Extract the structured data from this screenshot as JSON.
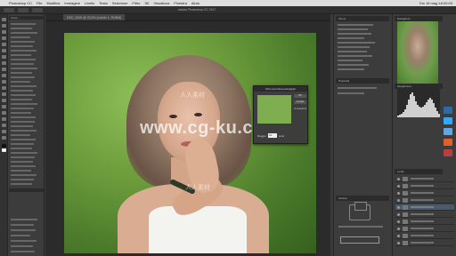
{
  "menubar": {
    "apple": "",
    "items": [
      "Photoshop CC",
      "File",
      "Modifica",
      "Immagine",
      "Livello",
      "Testo",
      "Selezione",
      "Filtro",
      "3D",
      "Visualizza",
      "Finestra",
      "Aiuto"
    ],
    "window_title": "Adobe Photoshop CC 2017",
    "clock": "Gio 16 mag 18:00:03"
  },
  "document_tab": {
    "label": "DSC_0245 @ 33,3% (Livello 1, RGB/8)"
  },
  "dialog": {
    "title": "Filtro accentua passaggio",
    "ok_label": "OK",
    "cancel_label": "Annulla",
    "preview_label": "Anteprima",
    "radius_label": "Raggio:",
    "radius_value": "10",
    "radius_unit": "pixel"
  },
  "watermark": {
    "main": "www.cg-ku.com",
    "top": "人人素材",
    "bottom": "人人素材"
  },
  "left_panel": {
    "section_history": "Storia"
  },
  "mid_panel": {
    "section_actions": "Azioni",
    "section_properties": "Proprietà",
    "section_libraries": "Librerie"
  },
  "right_panel": {
    "section_navigator": "Navigatore",
    "section_histogram": "Istogramma",
    "section_layers": "Livelli"
  },
  "filmstrip_icons": [
    {
      "name": "lightroom-icon",
      "color": "#2f6aa6"
    },
    {
      "name": "photoshop-icon",
      "color": "#31a8ff"
    },
    {
      "name": "finder-icon",
      "color": "#5fa8e6"
    },
    {
      "name": "firefox-icon",
      "color": "#e0602a"
    },
    {
      "name": "app-icon",
      "color": "#b44040"
    }
  ],
  "colors": {
    "accent": "#31a8ff",
    "panel": "#3c3c3c",
    "photo_bg": "#6e9e3c"
  }
}
